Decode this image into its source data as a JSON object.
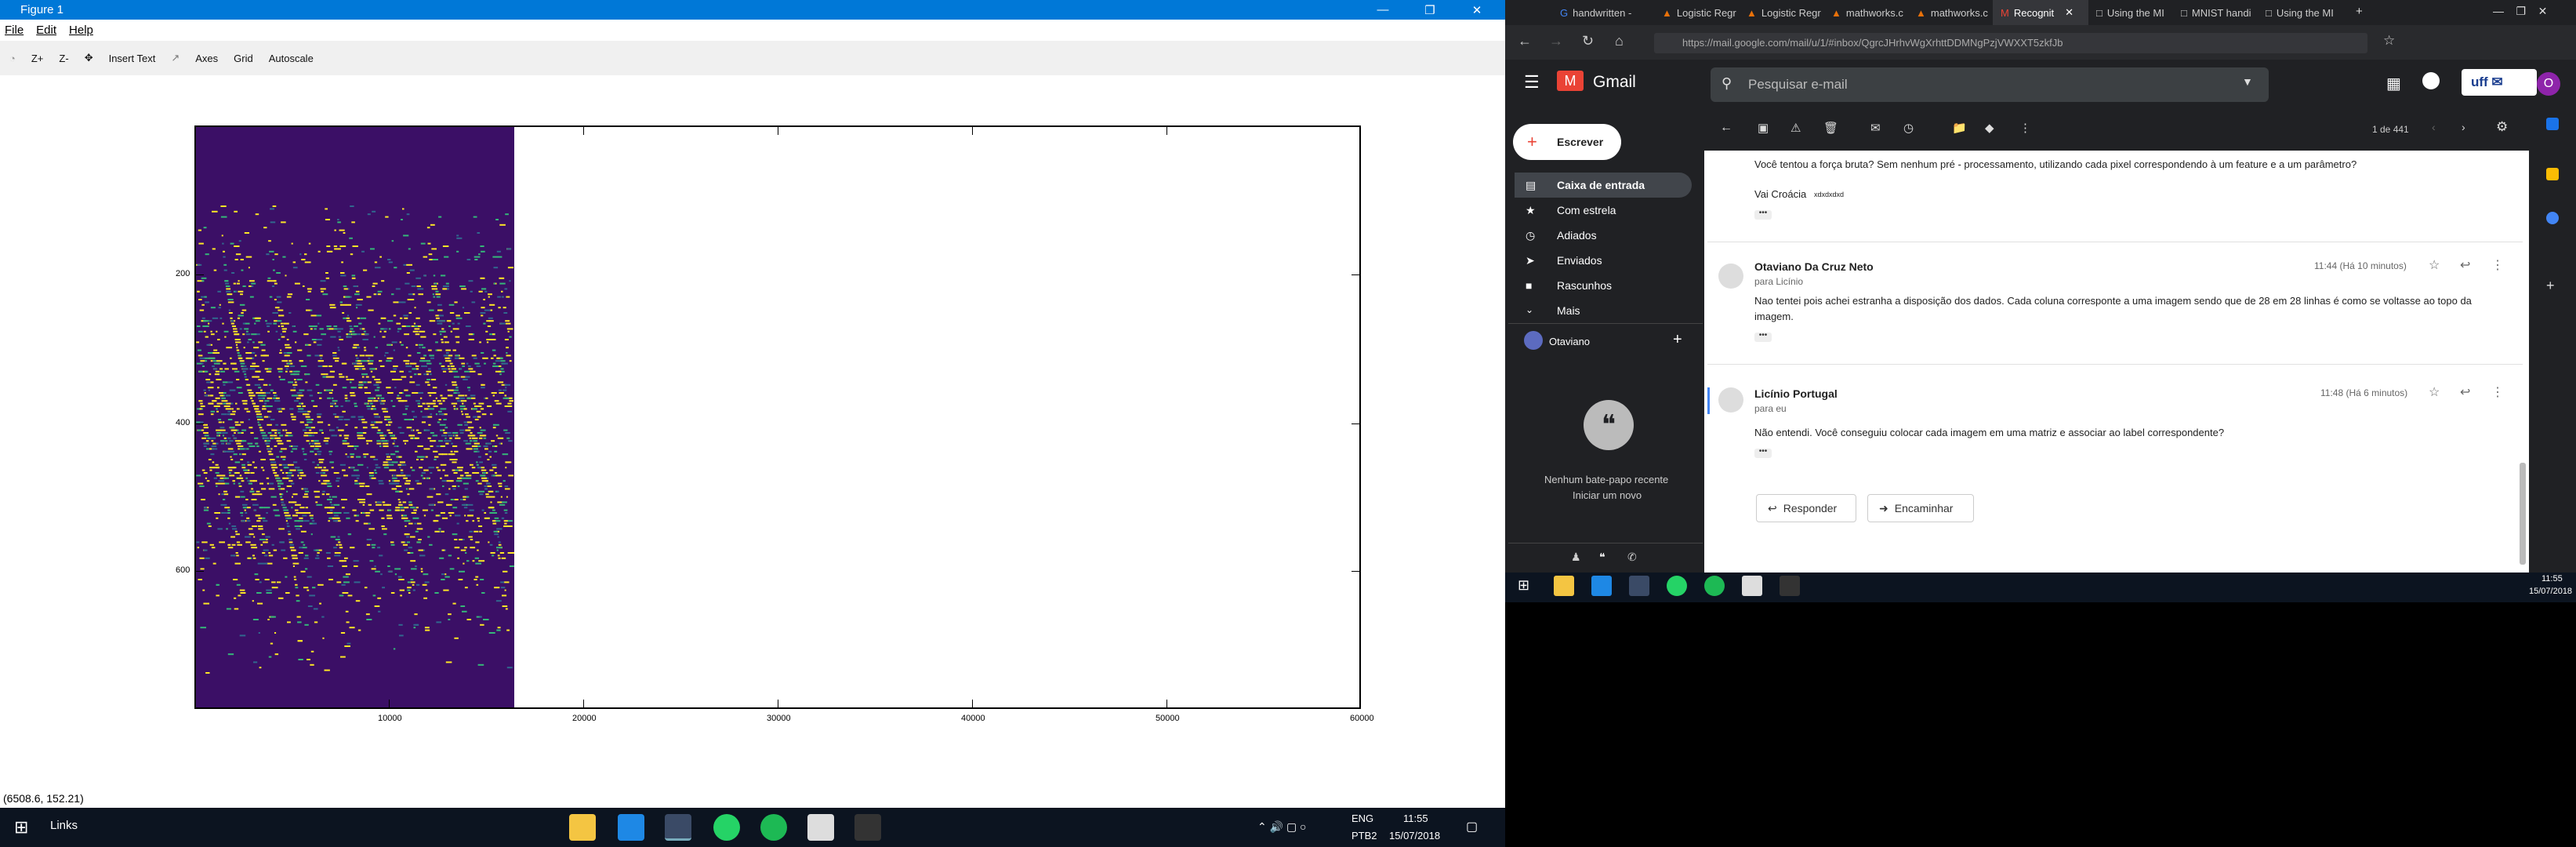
{
  "figure": {
    "title": "Figure 1",
    "menu": [
      "File",
      "Edit",
      "Help"
    ],
    "toolbar": [
      "Z+",
      "Z-",
      "Insert Text",
      "Axes",
      "Grid",
      "Autoscale"
    ],
    "status": "(6508.6, 152.21)",
    "y_ticks": [
      "200",
      "400",
      "600"
    ],
    "x_ticks": [
      "10000",
      "20000",
      "30000",
      "40000",
      "50000",
      "60000"
    ]
  },
  "taskbar_left": {
    "links": "Links",
    "lang": "ENG",
    "layout": "PTB2",
    "time": "11:55",
    "date": "15/07/2018"
  },
  "browser": {
    "tabs": [
      "handwritten -",
      "Logistic Regr",
      "Logistic Regr",
      "mathworks.c",
      "mathworks.c",
      "Recognit",
      "Using the MI",
      "MNIST handi",
      "Using the MI"
    ],
    "url": "https://mail.google.com/mail/u/1/#inbox/QgrcJHrhvWgXrhttDDMNgPzjVWXXT5zkfJb"
  },
  "gmail": {
    "brand": "Gmail",
    "search_placeholder": "Pesquisar e-mail",
    "compose": "Escrever",
    "nav": [
      "Caixa de entrada",
      "Com estrela",
      "Adiados",
      "Enviados",
      "Rascunhos",
      "Mais"
    ],
    "account": "Otaviano",
    "hangouts_empty": "Nenhum bate-papo recente",
    "hangouts_start": "Iniciar um novo",
    "pager": "1 de 441",
    "thread": {
      "prev_text1": "Você tentou a força bruta? Sem nenhum pré - processamento, utilizando cada pixel correspondendo à um feature e a um parâmetro?",
      "prev_text2": "Vai Croácia",
      "prev_text2_small": "xdxdxdxd",
      "m1_sender": "Otaviano Da Cruz Neto",
      "m1_to": "para Licínio",
      "m1_time": "11:44 (Há 10 minutos)",
      "m1_body": "Nao tentei pois achei estranha a disposição dos dados. Cada coluna corresponte a uma imagem sendo que de 28 em 28 linhas é como se voltasse ao topo da imagem.",
      "m2_sender": "Licínio Portugal",
      "m2_to": "para eu",
      "m2_time": "11:48 (Há 6 minutos)",
      "m2_body": "Não entendi. Você conseguiu colocar cada imagem em uma matriz e associar ao label correspondente?",
      "reply": "Responder",
      "forward": "Encaminhar",
      "dots": "•••"
    }
  },
  "taskbar_right": {
    "time": "11:55",
    "date": "15/07/2018"
  }
}
